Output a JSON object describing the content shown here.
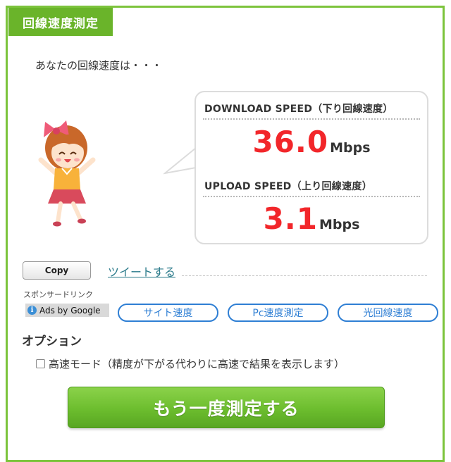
{
  "header": {
    "title": "回線速度測定"
  },
  "intro_text": "あなたの回線速度は・・・",
  "result": {
    "download_label": "DOWNLOAD SPEED（下り回線速度）",
    "download_value": "36.0",
    "download_unit": "Mbps",
    "upload_label": "UPLOAD SPEED（上り回線速度）",
    "upload_value": "3.1",
    "upload_unit": "Mbps"
  },
  "actions": {
    "copy_label": "Copy",
    "tweet_label": "ツイートする"
  },
  "ads": {
    "sponsored_label": "スポンサードリンク",
    "ads_by_google": "Ads by Google",
    "links": [
      "サイト速度",
      "Pc速度測定",
      "光回線速度"
    ]
  },
  "options": {
    "heading": "オプション",
    "fast_mode_label": "高速モード（精度が下がる代わりに高速で結果を表示します）",
    "fast_mode_checked": false
  },
  "remeasure_label": "もう一度測定する",
  "colors": {
    "brand_green": "#6ab42a",
    "speed_red": "#f2262a",
    "link_blue": "#2f7fd4"
  },
  "icons": [
    "info-icon",
    "girl-mascot-illustration"
  ]
}
